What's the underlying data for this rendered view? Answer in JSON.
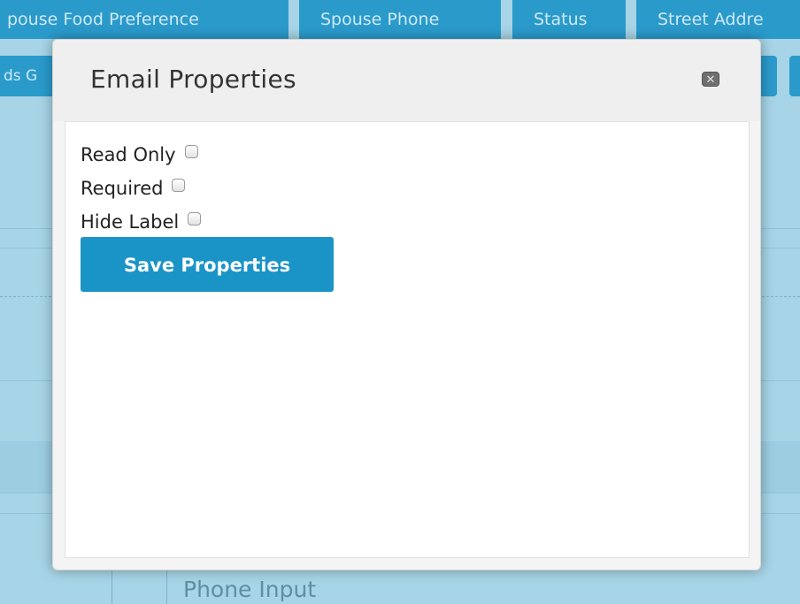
{
  "background": {
    "column_tabs": [
      "pouse Food Preference",
      "Spouse Phone",
      "Status",
      "Street Addre"
    ],
    "second_row_fragment": "ds G",
    "field_label": "Phone Input"
  },
  "modal": {
    "title": "Email Properties",
    "close_icon": "close-icon",
    "options": [
      {
        "label": "Read Only",
        "checked": false
      },
      {
        "label": "Required",
        "checked": false
      },
      {
        "label": "Hide Label",
        "checked": false
      }
    ],
    "save_label": "Save Properties"
  },
  "colors": {
    "accent": "#1a94c7",
    "backdrop": "#a7d4e6",
    "tab_background": "#2a9acb"
  }
}
